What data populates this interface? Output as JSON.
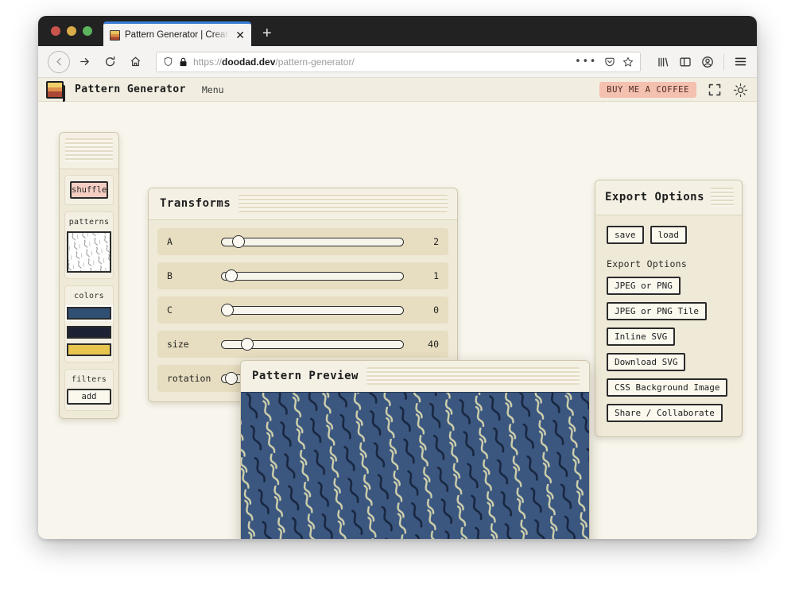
{
  "browser": {
    "tab_title": "Pattern Generator | Create Sea",
    "tab_close_label": "✕",
    "new_tab_label": "+",
    "url_prefix": "https://",
    "url_domain": "doodad.dev",
    "url_path": "/pattern-generator/",
    "icons": {
      "back": "back-arrow-icon",
      "forward": "forward-arrow-icon",
      "reload": "reload-icon",
      "home": "home-icon",
      "shield": "shield-icon",
      "lock": "lock-icon",
      "more": "ellipsis-icon",
      "pocket": "pocket-icon",
      "bookmark": "star-icon",
      "library": "library-icon",
      "sidebar": "sidebar-icon",
      "account": "account-icon",
      "menu": "hamburger-menu-icon"
    }
  },
  "app": {
    "title": "Pattern Generator",
    "menu_label": "Menu",
    "coffee_button": "BUY ME A COFFEE",
    "fullscreen_icon": "fullscreen-icon",
    "theme_icon": "sun-icon",
    "logo_icon": "layers-logo-icon"
  },
  "sidebar": {
    "shuffle_label": "shuffle",
    "patterns_label": "patterns",
    "colors_label": "colors",
    "filters_label": "filters",
    "filters_add_label": "add",
    "colors": [
      {
        "name": "steel-blue",
        "hex": "#2f4f73"
      },
      {
        "name": "dark-navy",
        "hex": "#1c2233"
      },
      {
        "name": "golden-yellow",
        "hex": "#e8c54f"
      }
    ]
  },
  "transforms": {
    "title": "Transforms",
    "sliders": [
      {
        "label": "A",
        "value": "2",
        "percent": 6
      },
      {
        "label": "B",
        "value": "1",
        "percent": 2
      },
      {
        "label": "C",
        "value": "0",
        "percent": 0
      },
      {
        "label": "size",
        "value": "40",
        "percent": 11
      },
      {
        "label": "rotation",
        "value": "",
        "percent": 2
      }
    ]
  },
  "export": {
    "title": "Export Options",
    "save_label": "save",
    "load_label": "load",
    "section_label": "Export Options",
    "buttons": [
      "JPEG or PNG",
      "JPEG or PNG Tile",
      "Inline SVG",
      "Download SVG",
      "CSS Background Image",
      "Share / Collaborate"
    ]
  },
  "preview": {
    "title": "Pattern Preview",
    "background_hex": "#3b5780",
    "motif_dark_hex": "#1b2a44",
    "motif_light_hex": "#cfd0ab",
    "motif_name": "s-curve-squiggle"
  }
}
